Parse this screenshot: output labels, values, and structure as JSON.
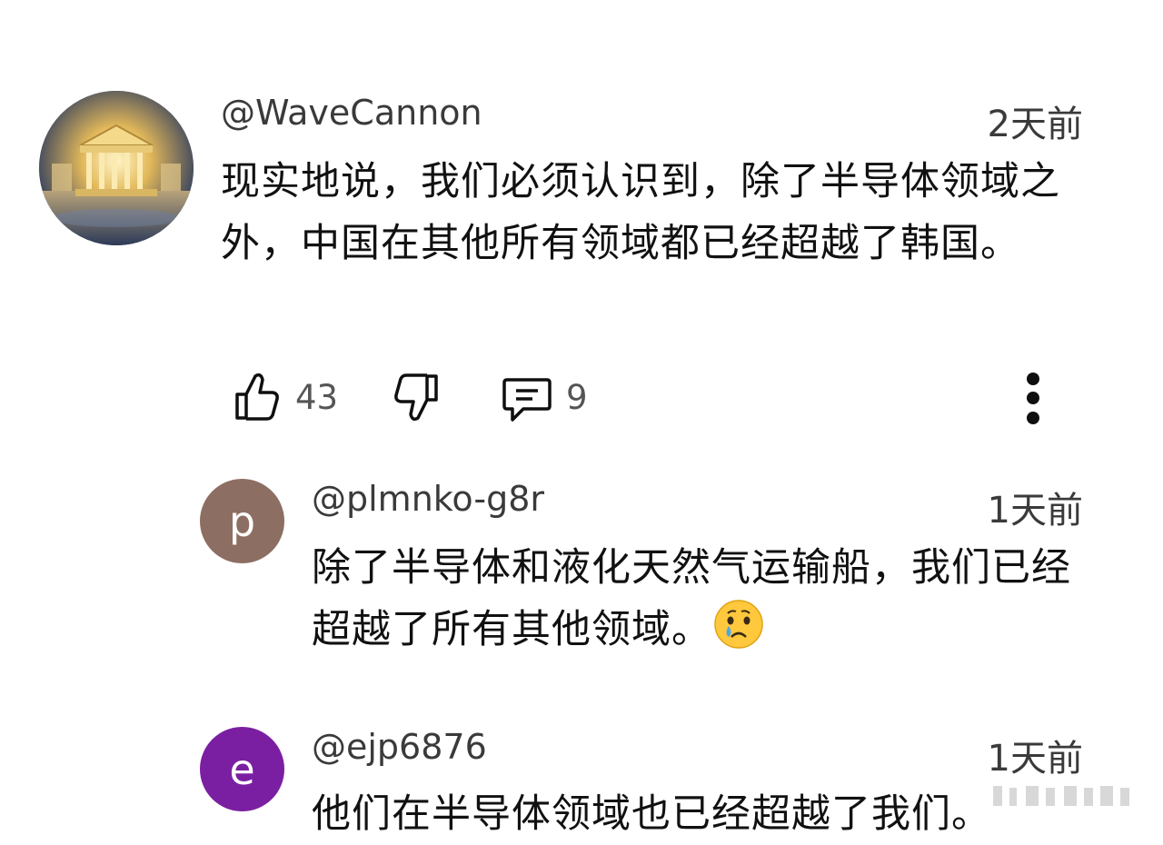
{
  "comments": [
    {
      "handle": "@WaveCannon",
      "time": "2天前",
      "text": "现实地说，我们必须认识到，除了半导体领域之外，中国在其他所有领域都已经超越了韩国。",
      "likes": "43",
      "replies": "9",
      "avatar_icon": "temple-image"
    },
    {
      "handle": "@plmnko-g8r",
      "avatar_letter": "p",
      "avatar_color": "#8d6e63",
      "time": "1天前",
      "text": "除了半导体和液化天然气运输船，我们已经超越了所有其他领域。",
      "emoji_icon": "crying-face-icon"
    },
    {
      "handle": "@ejp6876",
      "avatar_letter": "e",
      "avatar_color": "#7b1fa2",
      "time": "1天前",
      "text": "他们在半导体领域也已经超越了我们。"
    }
  ]
}
